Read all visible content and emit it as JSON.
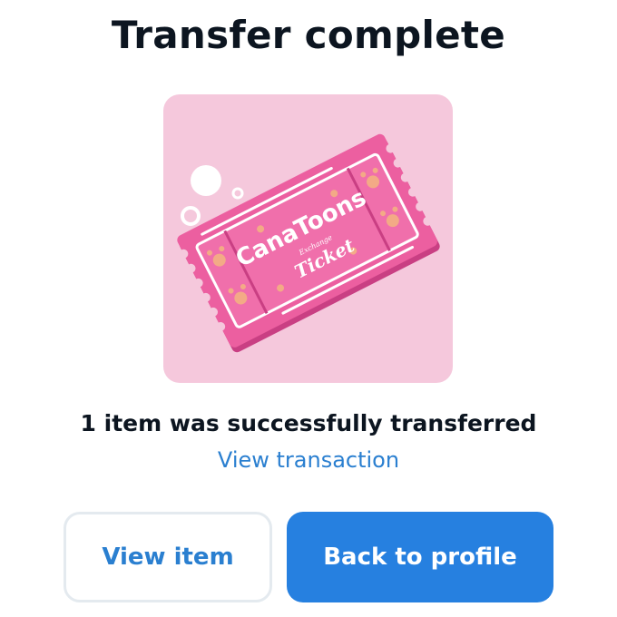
{
  "header": {
    "title": "Transfer complete"
  },
  "item_image": {
    "brand_text": "CanaToons",
    "small_text": "Exchange",
    "ticket_text": "Ticket"
  },
  "result": {
    "message": "1 item was successfully transferred",
    "link_label": "View transaction"
  },
  "actions": {
    "view_item_label": "View item",
    "back_label": "Back to profile"
  },
  "colors": {
    "accent": "#2680e0",
    "link": "#2a7fd0",
    "card_bg": "#f5c8dc",
    "ticket_pink": "#ec5fa0"
  }
}
